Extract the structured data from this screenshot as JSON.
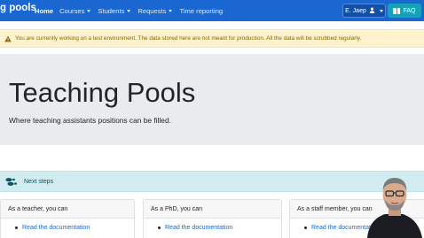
{
  "navbar": {
    "brand": "g pools",
    "items": [
      {
        "label": "Home",
        "active": true,
        "dropdown": false
      },
      {
        "label": "Courses",
        "active": false,
        "dropdown": true
      },
      {
        "label": "Students",
        "active": false,
        "dropdown": true
      },
      {
        "label": "Requests",
        "active": false,
        "dropdown": true
      },
      {
        "label": "Time reporting",
        "active": false,
        "dropdown": false
      }
    ],
    "user_label": "E. Jaep",
    "faq_label": "FAQ",
    "colors": {
      "bar": "#1a67d2",
      "faq": "#17a2b8"
    }
  },
  "alert": {
    "text": "You are currently working on a test environment. The data stored here are not meant for production. All the data will be scrubbed regularly.",
    "icon": "warning-triangle-icon"
  },
  "jumbotron": {
    "title": "Teaching Pools",
    "subtitle": "Where teaching assistants positions can be filled."
  },
  "next_steps": {
    "label": "Next steps",
    "icon": "footprints-icon"
  },
  "cards": [
    {
      "header": "As a teacher, you can",
      "link": "Read the documentation"
    },
    {
      "header": "As a PhD, you can",
      "link": "Read the documentation"
    },
    {
      "header": "As a staff member, you can",
      "link": "Read the documentation"
    }
  ]
}
